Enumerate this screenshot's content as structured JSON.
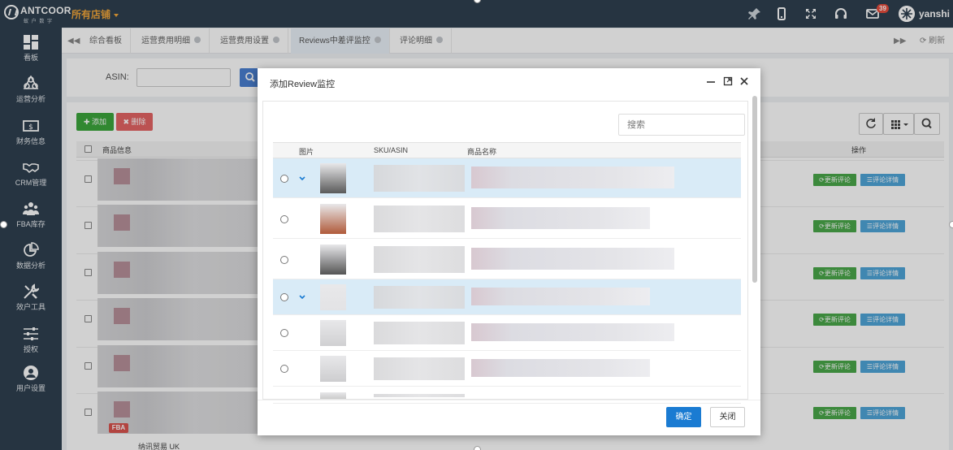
{
  "header": {
    "logo_text": "ANTCOOR",
    "logo_sub": "蚁 户 数 字",
    "store_selector": "所有店铺",
    "notification_count": "39",
    "username": "yanshi"
  },
  "sidebar": {
    "items": [
      {
        "label": "看板",
        "icon": "dashboard-icon"
      },
      {
        "label": "运营分析",
        "icon": "network-icon"
      },
      {
        "label": "财务信息",
        "icon": "money-icon"
      },
      {
        "label": "CRM管理",
        "icon": "handshake-icon"
      },
      {
        "label": "FBA库存",
        "icon": "users-icon"
      },
      {
        "label": "数据分析",
        "icon": "pie-chart-icon"
      },
      {
        "label": "效户工具",
        "icon": "tools-icon"
      },
      {
        "label": "授权",
        "icon": "sliders-icon"
      },
      {
        "label": "用户设置",
        "icon": "user-icon"
      }
    ]
  },
  "tabs": {
    "items": [
      {
        "label": "综合看板",
        "closable": false
      },
      {
        "label": "运营费用明细",
        "closable": true
      },
      {
        "label": "运营费用设置",
        "closable": true
      },
      {
        "label": "Reviews中差评监控",
        "closable": true,
        "active": true
      },
      {
        "label": "评论明细",
        "closable": true
      }
    ],
    "refresh_label": "刷新"
  },
  "filter": {
    "asin_label": "ASIN:",
    "asin_value": ""
  },
  "toolbar": {
    "add_label": "添加",
    "delete_label": "删除"
  },
  "table": {
    "col_product": "商品信息",
    "col_action": "操作",
    "update_btn": "更新评论",
    "detail_btn": "评论详情",
    "fba_badge": "FBA",
    "partial_row_text": "纳讯贸易 UK"
  },
  "modal": {
    "title": "添加Review监控",
    "search_placeholder": "搜索",
    "columns": [
      "图片",
      "SKU/ASIN",
      "商品名称"
    ],
    "confirm_label": "确定",
    "close_label": "关闭",
    "selected_rows": [
      0,
      3
    ]
  },
  "colors": {
    "sidebar_bg": "#2f4050",
    "accent_orange": "#f4a83a",
    "btn_green": "#3ca63c",
    "btn_red": "#e46565",
    "btn_blue": "#1a7bd2",
    "row_selected": "#d9ebf7"
  }
}
